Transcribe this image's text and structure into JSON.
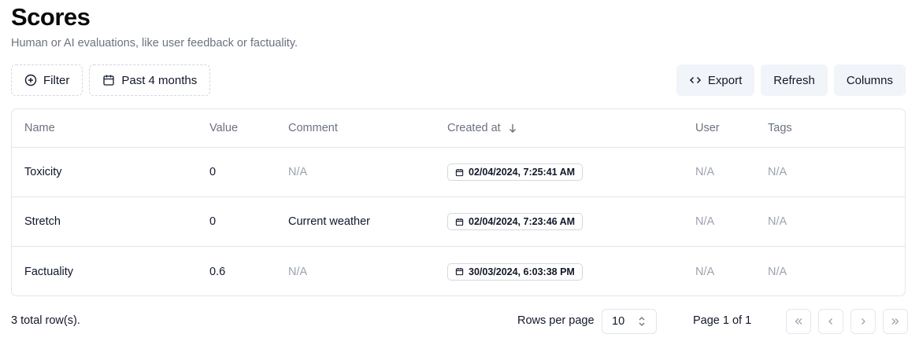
{
  "header": {
    "title": "Scores",
    "subtitle": "Human or AI evaluations, like user feedback or factuality."
  },
  "toolbar": {
    "filter_label": "Filter",
    "date_range_label": "Past 4 months",
    "export_label": "Export",
    "refresh_label": "Refresh",
    "columns_label": "Columns"
  },
  "table": {
    "columns": [
      "Name",
      "Value",
      "Comment",
      "Created at",
      "User",
      "Tags"
    ],
    "sort": {
      "column": "Created at",
      "direction": "descending"
    },
    "rows": [
      {
        "name": "Toxicity",
        "value": "0",
        "comment": "N/A",
        "created_at": "02/04/2024, 7:25:41 AM",
        "user": "N/A",
        "tags": "N/A"
      },
      {
        "name": "Stretch",
        "value": "0",
        "comment": "Current weather",
        "created_at": "02/04/2024, 7:23:46 AM",
        "user": "N/A",
        "tags": "N/A"
      },
      {
        "name": "Factuality",
        "value": "0.6",
        "comment": "N/A",
        "created_at": "30/03/2024, 6:03:38 PM",
        "user": "N/A",
        "tags": "N/A"
      }
    ]
  },
  "footer": {
    "total_rows": "3 total row(s).",
    "rows_per_page_label": "Rows per page",
    "rows_per_page_value": "10",
    "page_label": "Page 1 of 1"
  },
  "icons": {
    "filter": "plus-circle-icon",
    "date": "calendar-icon",
    "export": "code-icon",
    "sort": "arrow-down-icon",
    "select": "chevrons-up-down-icon",
    "first": "chevrons-left-icon",
    "prev": "chevron-left-icon",
    "next": "chevron-right-icon",
    "last": "chevrons-right-icon"
  }
}
